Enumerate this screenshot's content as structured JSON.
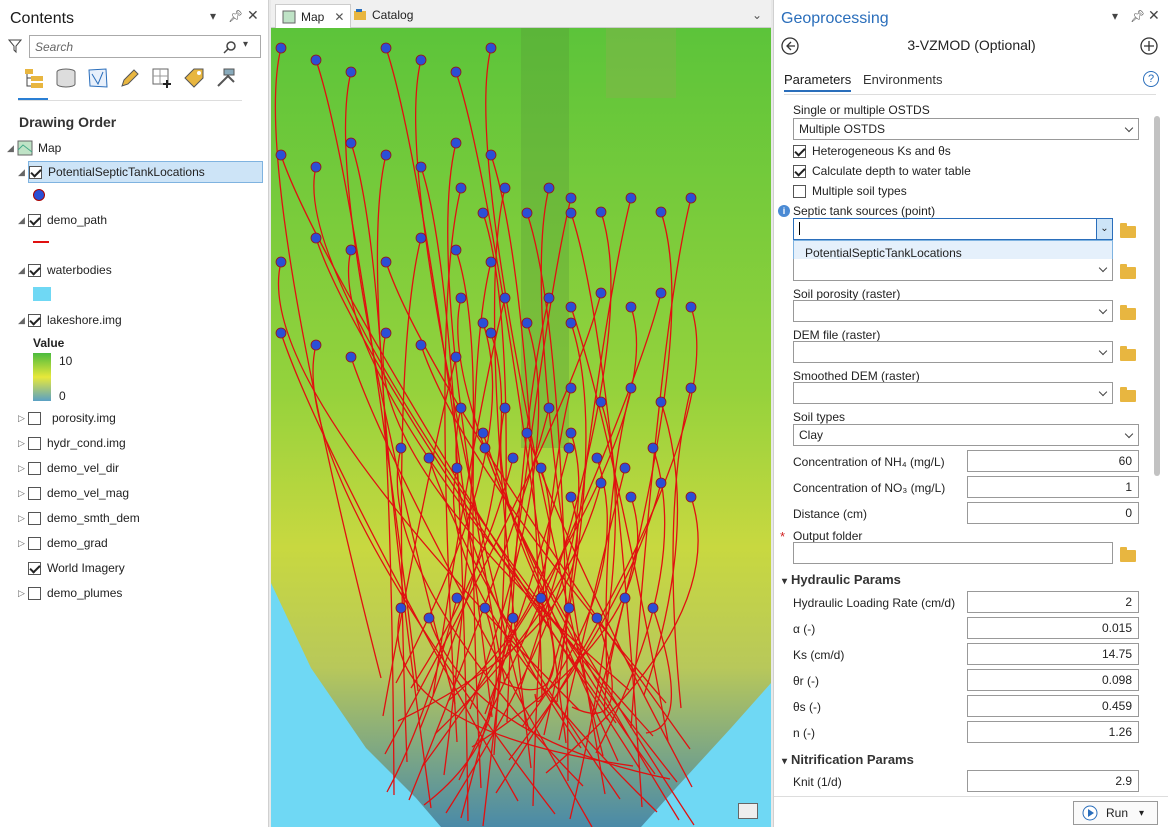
{
  "contents": {
    "title": "Contents",
    "search_placeholder": "Search",
    "drawing_order": "Drawing Order",
    "layers": [
      {
        "name": "Map",
        "checked": null
      },
      {
        "name": "PotentialSepticTankLocations",
        "checked": true
      },
      {
        "name": "demo_path",
        "checked": true
      },
      {
        "name": "waterbodies",
        "checked": true
      },
      {
        "name": "lakeshore.img",
        "checked": true
      },
      {
        "name": "porosity.img",
        "checked": false
      },
      {
        "name": "hydr_cond.img",
        "checked": false
      },
      {
        "name": "demo_vel_dir",
        "checked": false
      },
      {
        "name": "demo_vel_mag",
        "checked": false
      },
      {
        "name": "demo_smth_dem",
        "checked": false
      },
      {
        "name": "demo_grad",
        "checked": false
      },
      {
        "name": "World Imagery",
        "checked": true
      },
      {
        "name": "demo_plumes",
        "checked": false
      }
    ],
    "legend": {
      "label": "Value",
      "high": "10",
      "low": "0"
    }
  },
  "map": {
    "tab_map": "Map",
    "tab_catalog": "Catalog",
    "point_color": "#2a4fd6",
    "line_color": "#e01010",
    "water_color": "#6fd8f4"
  },
  "gp": {
    "title": "Geoprocessing",
    "tool": "3-VZMOD (Optional)",
    "tab_params": "Parameters",
    "tab_env": "Environments",
    "single_label": "Single or multiple OSTDS",
    "single_value": "Multiple OSTDS",
    "chk_hetero": "Heterogeneous Ks and θs",
    "chk_depth": "Calculate depth to water table",
    "chk_soil": "Multiple soil types",
    "septic_label": "Septic tank sources (point)",
    "septic_option": "PotentialSepticTankLocations",
    "porosity_label": "Soil porosity (raster)",
    "dem_label": "DEM file (raster)",
    "sdem_label": "Smoothed DEM (raster)",
    "soiltypes_label": "Soil types",
    "soiltypes_value": "Clay",
    "nh4_label": "Concentration of NH₄ (mg/L)",
    "nh4_value": "60",
    "no3_label": "Concentration of NO₃ (mg/L)",
    "no3_value": "1",
    "dist_label": "Distance (cm)",
    "dist_value": "0",
    "out_label": "Output folder",
    "hyd_group": "Hydraulic Params",
    "hlr_label": "Hydraulic Loading Rate (cm/d)",
    "hlr_value": "2",
    "alpha_label": "α (-)",
    "alpha_value": "0.015",
    "ks_label": "Ks (cm/d)",
    "ks_value": "14.75",
    "thr_label": "θr (-)",
    "thr_value": "0.098",
    "ths_label": "θs (-)",
    "ths_value": "0.459",
    "n_label": "n (-)",
    "n_value": "1.26",
    "nit_group": "Nitrification Params",
    "knit_label": "Knit (1/d)",
    "knit_value": "2.9",
    "run": "Run"
  }
}
